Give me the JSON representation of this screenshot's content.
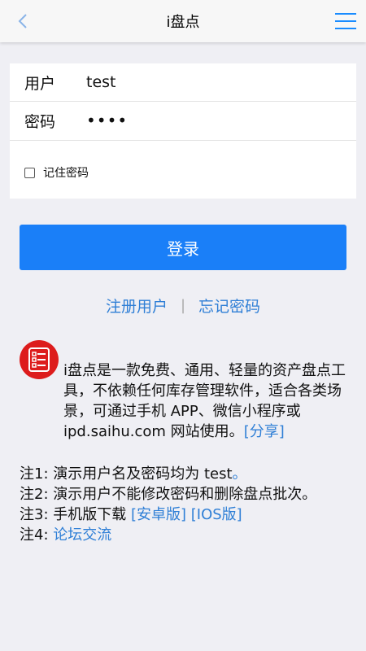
{
  "header": {
    "title": "i盘点",
    "back_icon": "chevron-left-icon",
    "menu_icon": "hamburger-menu-icon",
    "accent_color": "#1a8cff"
  },
  "form": {
    "username_label": "用户",
    "username_value": "test",
    "password_label": "密码",
    "password_value": "••••",
    "remember_label": "记住密码",
    "remember_checked": false
  },
  "login_button": {
    "label": "登录",
    "color": "#1a7ff8"
  },
  "links": {
    "register": "注册用户",
    "separator": "|",
    "forgot": "忘记密码"
  },
  "info": {
    "logo_icon": "checklist-icon",
    "logo_color": "#dd1c1c",
    "description": "i盘点是一款免费、通用、轻量的资产盘点工具，不依赖任何库存管理软件，适合各类场景，可通过手机 APP、微信小程序或 ipd.saihu.com 网站使用。",
    "share_link": "[分享]"
  },
  "notes": {
    "note1_prefix": "注1: 演示用户名及密码均为 test",
    "note1_suffix": "。",
    "note2": "注2: 演示用户不能修改密码和删除盘点批次。",
    "note3_prefix": "注3: 手机版下载 ",
    "note3_android": "[安卓版]",
    "note3_ios": "[IOS版]",
    "note4_prefix": "注4: ",
    "note4_link": "论坛交流"
  }
}
